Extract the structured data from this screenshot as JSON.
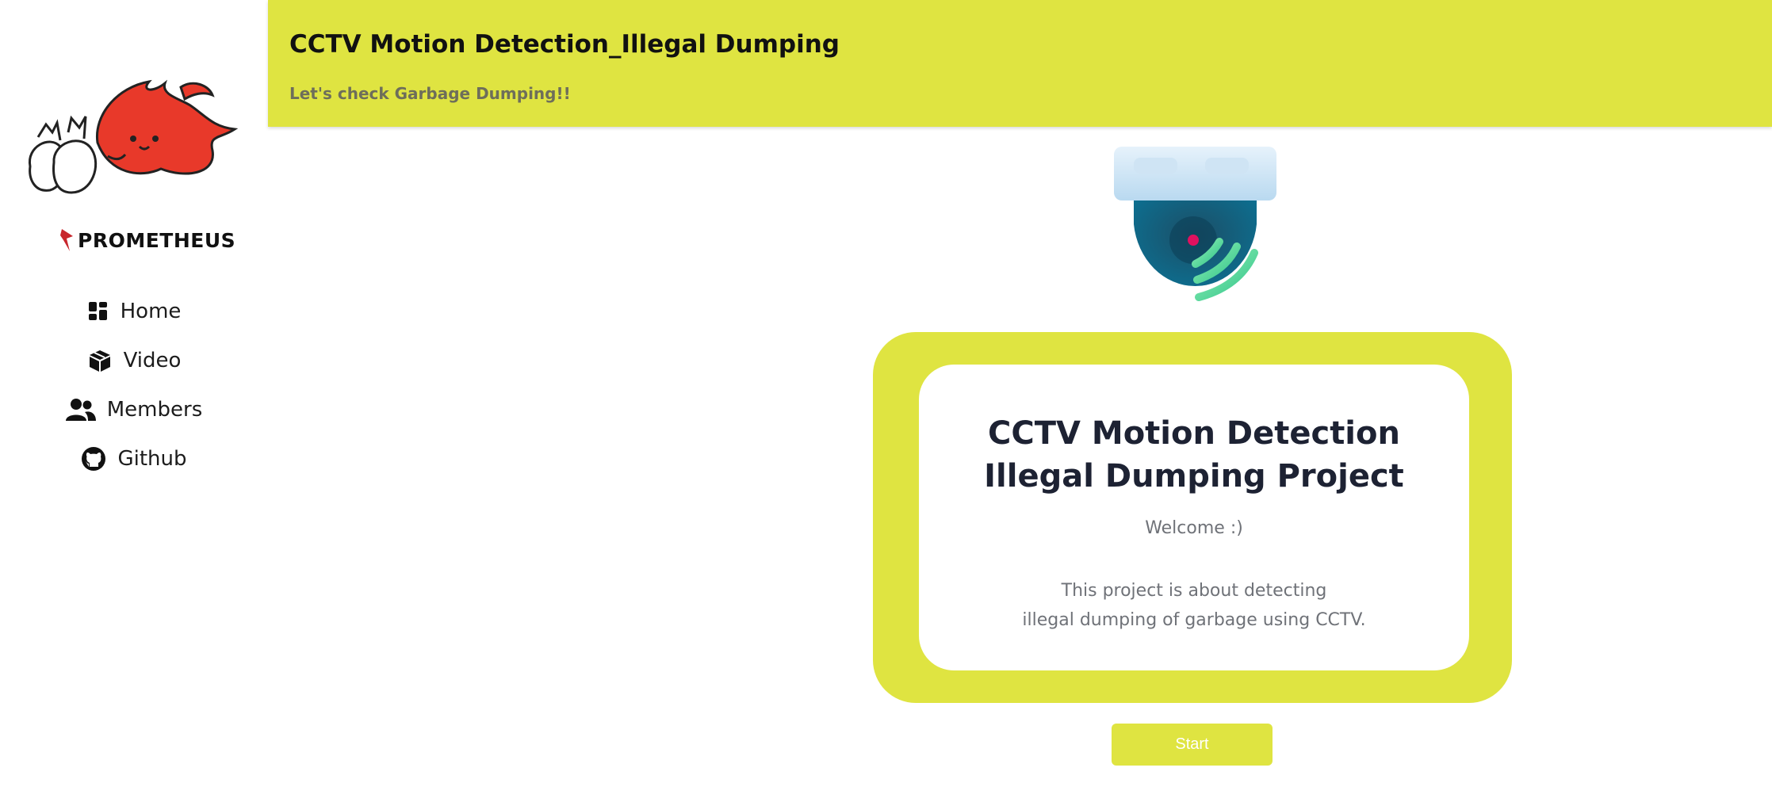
{
  "sidebar": {
    "brand": "PROMETHEUS",
    "items": [
      {
        "label": "Home",
        "icon": "dashboard-icon"
      },
      {
        "label": "Video",
        "icon": "box-icon"
      },
      {
        "label": "Members",
        "icon": "users-icon"
      },
      {
        "label": "Github",
        "icon": "github-icon"
      }
    ]
  },
  "header": {
    "title": "CCTV Motion Detection_Illegal Dumping",
    "subtitle": "Let's check Garbage Dumping!!"
  },
  "card": {
    "title_line1": "CCTV Motion Detection",
    "title_line2": "Illegal Dumping Project",
    "welcome": "Welcome :)",
    "desc_line1": "This project is about detecting",
    "desc_line2": "illegal dumping of garbage using CCTV."
  },
  "start_button": "Start",
  "colors": {
    "accent": "#dfe441",
    "mascot": "#e8392a",
    "title_text": "#1d2233",
    "muted_text": "#6f7278"
  }
}
